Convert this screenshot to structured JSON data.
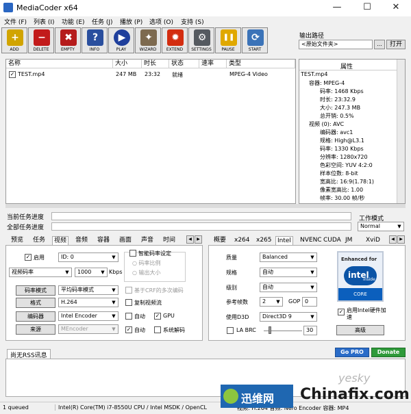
{
  "window": {
    "title": "MediaCoder x64",
    "min": "—",
    "max": "☐",
    "close": "✕"
  },
  "menu": [
    "文件 (F)",
    "列表 (I)",
    "功能 (E)",
    "任务 (J)",
    "播放 (P)",
    "选项 (O)",
    "支持 (S)"
  ],
  "toolbar": [
    {
      "label": "ADD",
      "icon": "add-icon",
      "color": "#d1a400",
      "glyph": "+"
    },
    {
      "label": "DELETE",
      "icon": "delete-icon",
      "color": "#c21b1b",
      "glyph": "−"
    },
    {
      "label": "EMPTY",
      "icon": "empty-icon",
      "color": "#b51c1c",
      "glyph": "✖"
    },
    {
      "label": "INFO",
      "icon": "info-icon",
      "color": "#2a4f9e",
      "glyph": "?"
    },
    {
      "label": "PLAY",
      "icon": "play-icon",
      "color": "#1f3f9c",
      "glyph": "▶"
    },
    {
      "label": "WIZARD",
      "icon": "wizard-icon",
      "color": "#7d6a4f",
      "glyph": "✦"
    },
    {
      "label": "EXTEND",
      "icon": "extend-icon",
      "color": "#d32d10",
      "glyph": "✹"
    },
    {
      "label": "SETTINGS",
      "icon": "settings-icon",
      "color": "#555a60",
      "glyph": "⚙"
    },
    {
      "label": "PAUSE",
      "icon": "pause-icon",
      "color": "#e0a800",
      "glyph": "❚❚"
    },
    {
      "label": "START",
      "icon": "start-icon",
      "color": "#3b73b8",
      "glyph": "⟳"
    }
  ],
  "output": {
    "label": "输出路径",
    "value": "<原始文件夹>",
    "browse": "...",
    "open": "打开"
  },
  "list": {
    "headers": [
      "名称",
      "大小",
      "时长",
      "状态",
      "速率",
      "类型"
    ],
    "rows": [
      {
        "checked": "✓",
        "name": "TEST.mp4",
        "size": "247 MB",
        "duration": "23:32",
        "status": "就绪",
        "rate": "",
        "type": "MPEG-4 Video"
      }
    ]
  },
  "props": {
    "header": "属性",
    "lines": [
      "TEST.mp4",
      "容器: MPEG-4",
      "码率: 1468 Kbps",
      "时长: 23:32.9",
      "大小: 247.3 MB",
      "总开销: 0.5%",
      "视频 (0): AVC",
      "编码器: avc1",
      "规格: High@L3.1",
      "码率: 1330 Kbps",
      "分辨率: 1280x720",
      "色彩空间: YUV 4:2:0",
      "样本位数: 8-bit",
      "宽高比: 16:9(1.78:1)",
      "像素宽高比: 1.00",
      "帧率: 30.00 帧/秒"
    ]
  },
  "progress": {
    "current": "当前任务进度",
    "total": "全部任务进度",
    "mode_label": "工作模式",
    "mode_value": "Normal"
  },
  "tabs_left": [
    "预览",
    "任务",
    "视频",
    "音频",
    "容器",
    "画面",
    "声音",
    "时间"
  ],
  "tabs_right": [
    "概要",
    "x264",
    "x265",
    "Intel",
    "NVENC",
    "CUDA",
    "JM",
    "XviD"
  ],
  "video": {
    "enable": "启用",
    "enable_check": "✓",
    "id": "ID: 0",
    "mode": "视频码率",
    "bitrate": "1000",
    "kbps": "Kbps",
    "smart": "智能码率设定",
    "ratio": "码率比例",
    "outsize": "输出大小",
    "rc_btn": "码率模式",
    "rc_value": "平均码率模式",
    "crf": "基于CRF的多次编码",
    "fmt_btn": "格式",
    "fmt_value": "H.264",
    "copy": "复制视频流",
    "enc_btn": "编码器",
    "enc_value": "Intel Encoder",
    "auto1": "自动",
    "gpu": "GPU",
    "gpu_check": "✓",
    "src_btn": "来源",
    "src_value": "MEncoder",
    "auto2": "自动",
    "auto2_check": "✓",
    "sysdec": "系统解码"
  },
  "intel": {
    "quality_label": "质量",
    "quality": "Balanced",
    "profile_label": "规格",
    "profile": "自动",
    "level_label": "级别",
    "level": "自动",
    "ref_label": "参考帧数",
    "ref": "2",
    "gop_label": "GOP",
    "gop": "0",
    "d3d_label": "使用D3D",
    "d3d": "Direct3D 9",
    "labrc": "LA BRC",
    "labrc_val": "30",
    "badge_top": "Enhanced for",
    "badge_brand": "intel",
    "badge_inside": "inside",
    "badge_core": "CORE",
    "hw": "启用Intel硬件加速",
    "hw_check": "✓",
    "adv": "高级"
  },
  "rss": {
    "label": "尚无RSS讯息",
    "gopro": "Go PRO",
    "donate": "Donate"
  },
  "status": {
    "queue": "1 queued",
    "cpu": "Intel(R) Core(TM) i7-8550U CPU  / Intel MSDK / OpenCL",
    "video": "视频: H.264  音频: Nero Encoder  容器: MP4"
  },
  "watermark": {
    "yesky": "yesky",
    "cn": "迅维网",
    "en": "Chinafix.com"
  }
}
